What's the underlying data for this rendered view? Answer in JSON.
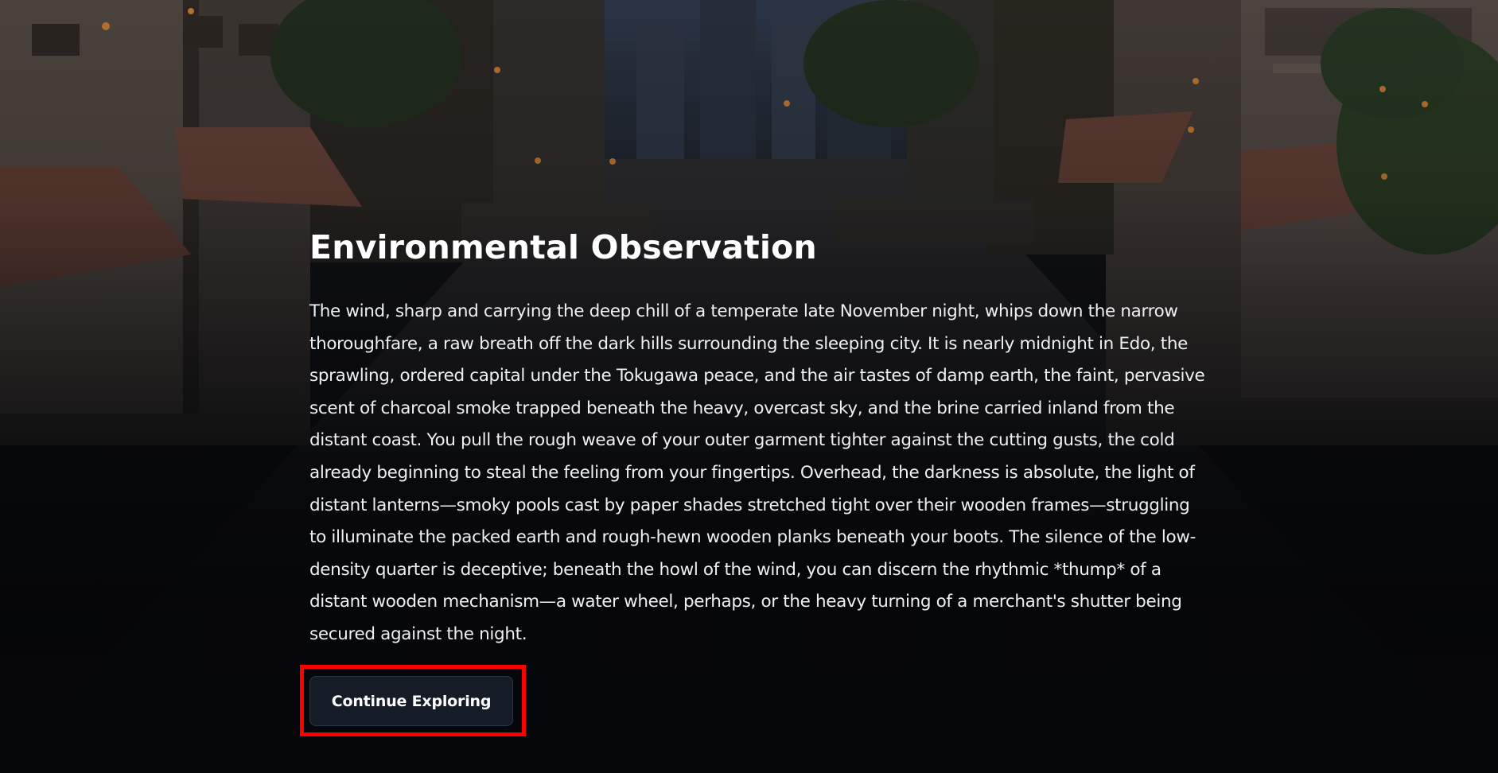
{
  "scene": {
    "title": "Environmental Observation",
    "narrative": "The wind, sharp and carrying the deep chill of a temperate late November night, whips down the narrow thoroughfare, a raw breath off the dark hills surrounding the sleeping city. It is nearly midnight in Edo, the sprawling, ordered capital under the Tokugawa peace, and the air tastes of damp earth, the faint, pervasive scent of charcoal smoke trapped beneath the heavy, overcast sky, and the brine carried inland from the distant coast. You pull the rough weave of your outer garment tighter against the cutting gusts, the cold already beginning to steal the feeling from your fingertips. Overhead, the darkness is absolute, the light of distant lanterns—smoky pools cast by paper shades stretched tight over their wooden frames—struggling to illuminate the packed earth and rough-hewn wooden planks beneath your boots. The silence of the low-density quarter is deceptive; beneath the howl of the wind, you can discern the rhythmic *thump* of a distant wooden mechanism—a water wheel, perhaps, or the heavy turning of a merchant's shutter being secured against the night.",
    "continue_label": "Continue Exploring"
  },
  "colors": {
    "background": "#07080b",
    "title_text": "#ffffff",
    "body_text": "#eef0f3",
    "button_bg": "#151b27",
    "button_border": "#2d3544",
    "highlight": "#ff0000"
  }
}
